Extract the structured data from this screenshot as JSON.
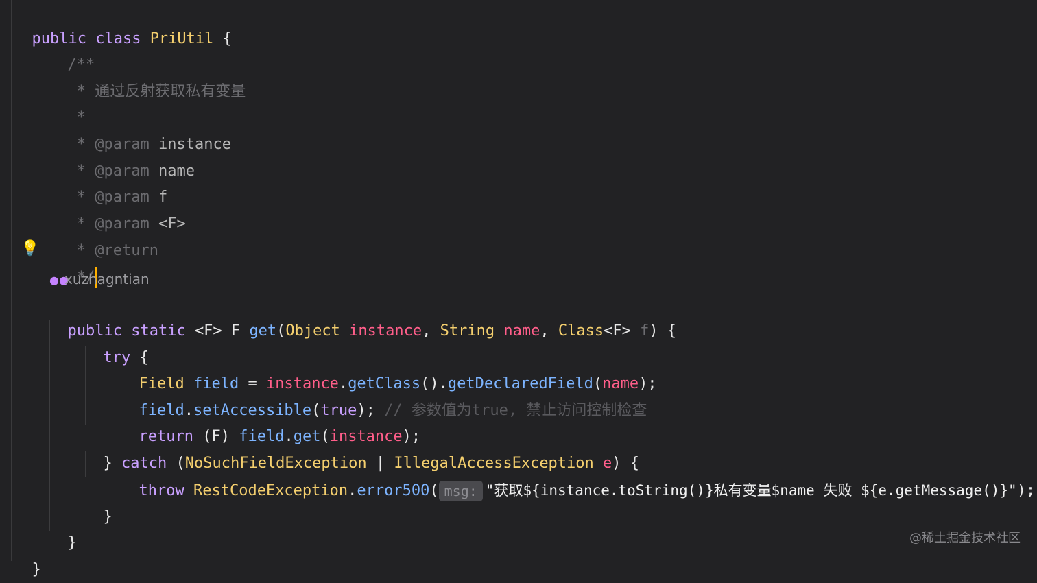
{
  "editor": {
    "lines": {
      "l1": {
        "kw": "public class ",
        "cls": "PriUtil",
        "rest": " {"
      },
      "l2": {
        "text": "/**"
      },
      "l3": {
        "text": " * 通过反射获取私有变量"
      },
      "l4": {
        "text": " *"
      },
      "l5": {
        "star": " * ",
        "tag": "@param",
        "val": " instance"
      },
      "l6": {
        "star": " * ",
        "tag": "@param",
        "val": " name"
      },
      "l7": {
        "star": " * ",
        "tag": "@param",
        "val": " f"
      },
      "l8": {
        "star": " * ",
        "tag": "@param",
        "val": " <F>"
      },
      "l9": {
        "star": " * ",
        "tag": "@return"
      },
      "l10": {
        "text": " */"
      },
      "l11": {
        "kw": "public static ",
        "p1": "<F> F ",
        "fn": "get",
        "p2": "(",
        "c1": "Object",
        "sp1": " ",
        "a1": "instance",
        "p3": ", ",
        "c2": "String",
        "sp2": " ",
        "a2": "name",
        "p4": ", ",
        "c3": "Class",
        "p5": "<F> ",
        "a3": "f",
        "p6": ") {"
      },
      "l12": {
        "kw": "try",
        "rest": " {"
      },
      "l13": {
        "c1": "Field",
        "sp": " ",
        "v": "field",
        "eq": " = ",
        "inst": "instance",
        "d1": ".",
        "f1": "getClass",
        "p1": "().",
        "f2": "getDeclaredField",
        "p2": "(",
        "a": "name",
        "p3": ");"
      },
      "l14": {
        "v": "field",
        "d1": ".",
        "f1": "setAccessible",
        "p1": "(",
        "kw": "true",
        "p2": "); ",
        "cmt": "// 参数值为true, 禁止访问控制检查"
      },
      "l15": {
        "kw": "return",
        "p1": " (F) ",
        "v": "field",
        "d1": ".",
        "f1": "get",
        "p2": "(",
        "a": "instance",
        "p3": ");"
      },
      "l16": {
        "p1": "} ",
        "kw": "catch",
        "p2": " (",
        "c1": "NoSuchFieldException",
        "p3": " | ",
        "c2": "IllegalAccessException",
        "sp": " ",
        "a": "e",
        "p4": ") {"
      },
      "l17": {
        "kw": "throw",
        "sp": " ",
        "c1": "RestCodeException",
        "d1": ".",
        "f1": "error500",
        "p1": "(",
        "hint": "msg:",
        "str": "\"获取${instance.toString()}私有变量$name 失败 ${e.getMessage()}\"",
        "p2": ");"
      },
      "l18": {
        "text": "}"
      },
      "l19": {
        "text": "}"
      },
      "l20": {
        "text": "}"
      }
    },
    "codelens_author": "xuzhagntian",
    "watermark": "@稀土掘金技术社区"
  }
}
